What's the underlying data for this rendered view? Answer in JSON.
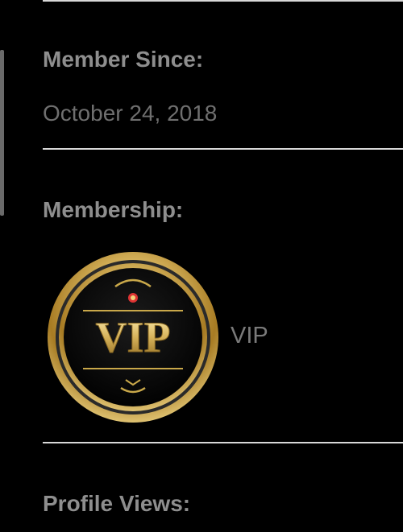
{
  "profile": {
    "member_since_label": "Member Since:",
    "member_since_value": "October 24, 2018",
    "membership_label": "Membership:",
    "membership_badge_text": "VIP",
    "membership_value": "VIP",
    "profile_views_label": "Profile Views:"
  },
  "colors": {
    "background": "#000000",
    "label": "#8e8e8e",
    "value": "#6f6f6f",
    "divider": "#d8d8d8",
    "gold": "#c9a84a"
  },
  "icons": {
    "membership_badge": "vip-badge-icon"
  }
}
